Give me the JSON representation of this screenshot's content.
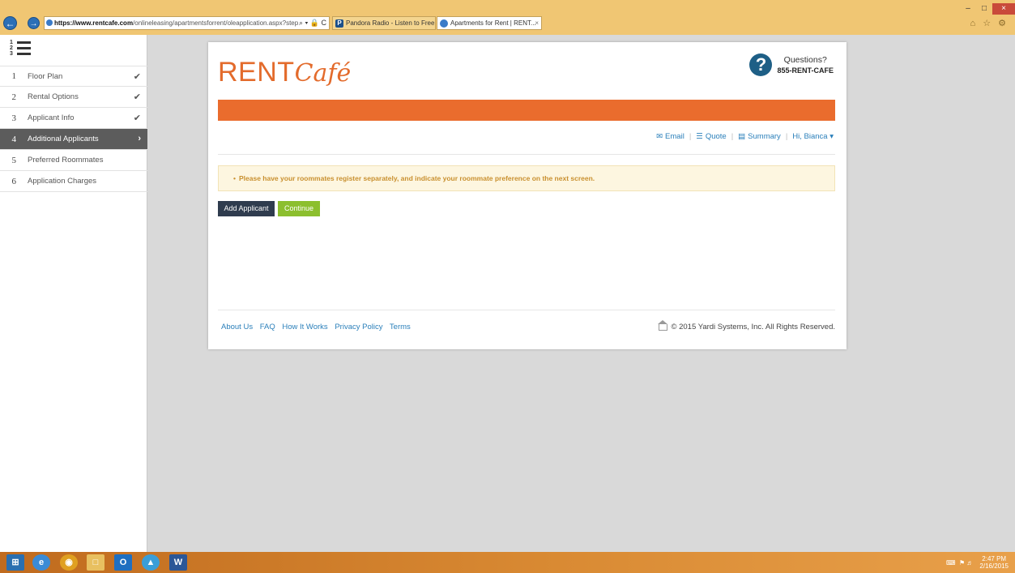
{
  "browser": {
    "url_domain": "https://www.rentcafe.com",
    "url_path": "/onlineleasing/apartmentsforrent/oleapplication.aspx?step",
    "url_controls": "⌕ ▾ 🔒 C",
    "tabs": [
      {
        "label": "Pandora Radio - Listen to Free ...",
        "icon": "P"
      },
      {
        "label": "Apartments for Rent | RENT...",
        "icon": ""
      }
    ],
    "tab_close": "×",
    "window_controls": {
      "minimize": "–",
      "restore": "□",
      "close": "×"
    },
    "toolbar_icons": "⌂ ☆ ⚙"
  },
  "sidebar": {
    "steps": [
      {
        "num": "1",
        "label": "Floor Plan",
        "mark": "✔"
      },
      {
        "num": "2",
        "label": "Rental Options",
        "mark": "✔"
      },
      {
        "num": "3",
        "label": "Applicant Info",
        "mark": "✔"
      },
      {
        "num": "4",
        "label": "Additional Applicants",
        "mark": "›"
      },
      {
        "num": "5",
        "label": "Preferred Roommates",
        "mark": ""
      },
      {
        "num": "6",
        "label": "Application Charges",
        "mark": ""
      }
    ]
  },
  "header": {
    "logo_rent": "RENT",
    "logo_cafe": "Café",
    "help_icon": "?",
    "help_question": "Questions?",
    "help_phone": "855-RENT-CAFE"
  },
  "toolbar": {
    "email": "Email",
    "quote": "Quote",
    "summary": "Summary",
    "user": "Hi, Bianca ▾",
    "sep": "|"
  },
  "notice": {
    "bullet": "•",
    "text": "Please have your roommates register separately, and indicate your roommate preference on the next screen."
  },
  "buttons": {
    "add_applicant": "Add Applicant",
    "continue": "Continue"
  },
  "footer": {
    "links": [
      "About Us",
      "FAQ",
      "How It Works",
      "Privacy Policy",
      "Terms"
    ],
    "copyright": "© 2015 Yardi Systems, Inc. All Rights Reserved."
  },
  "taskbar": {
    "time": "2:47 PM",
    "date": "2/16/2015"
  },
  "colors": {
    "brand_orange": "#ea6c2d",
    "link_blue": "#2a7fba",
    "continue_green": "#8cbf2e",
    "add_navy": "#2f3c4e"
  }
}
